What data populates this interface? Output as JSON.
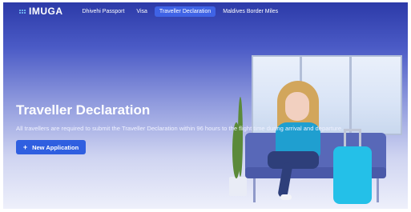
{
  "nav": {
    "logo": "IMUGA",
    "items": [
      {
        "label": "Dhivehi Passport",
        "active": false
      },
      {
        "label": "Visa",
        "active": false
      },
      {
        "label": "Traveller Declaration",
        "active": true
      },
      {
        "label": "Maldives Border Miles",
        "active": false
      }
    ]
  },
  "hero": {
    "title": "Traveller Declaration",
    "description": "All travellers are required to submit the Traveller Declaration within 96 hours to the flight time during arrival and departure.",
    "button_label": "New Application",
    "button_icon": "plus-icon"
  },
  "colors": {
    "nav_active": "#3f63e6",
    "button": "#2f5fe0",
    "hero_top": "#2c3aa8"
  }
}
